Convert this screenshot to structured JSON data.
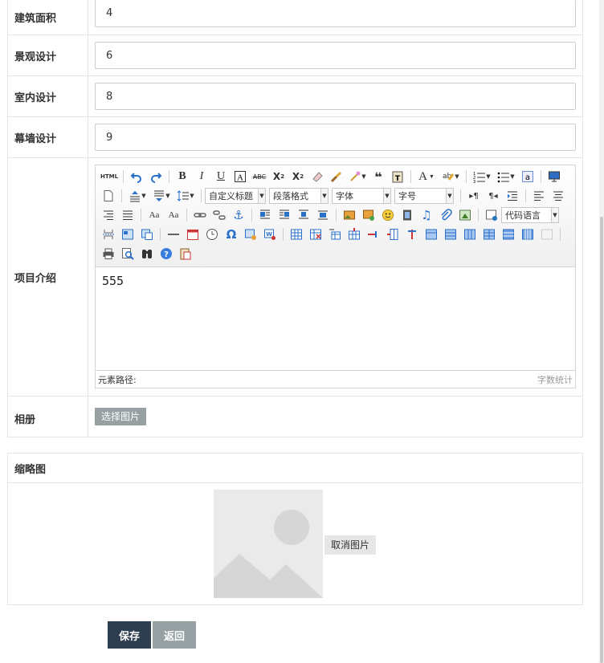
{
  "fields": [
    {
      "label": "建筑面积",
      "value": "4"
    },
    {
      "label": "景观设计",
      "value": "6"
    },
    {
      "label": "室内设计",
      "value": "8"
    },
    {
      "label": "幕墙设计",
      "value": "9"
    }
  ],
  "intro": {
    "label": "项目介绍",
    "content": "555",
    "toolbar": {
      "html_label": "HTML",
      "custom_title": "自定义标题",
      "paragraph": "段落格式",
      "font": "字体",
      "font_size": "字号",
      "code_lang": "代码语言"
    },
    "status_path": "元素路径:",
    "word_count": "字数统计"
  },
  "album": {
    "label": "相册",
    "button": "选择图片"
  },
  "thumbnail": {
    "title": "缩略图",
    "cancel": "取消图片"
  },
  "actions": {
    "save": "保存",
    "back": "返回"
  }
}
